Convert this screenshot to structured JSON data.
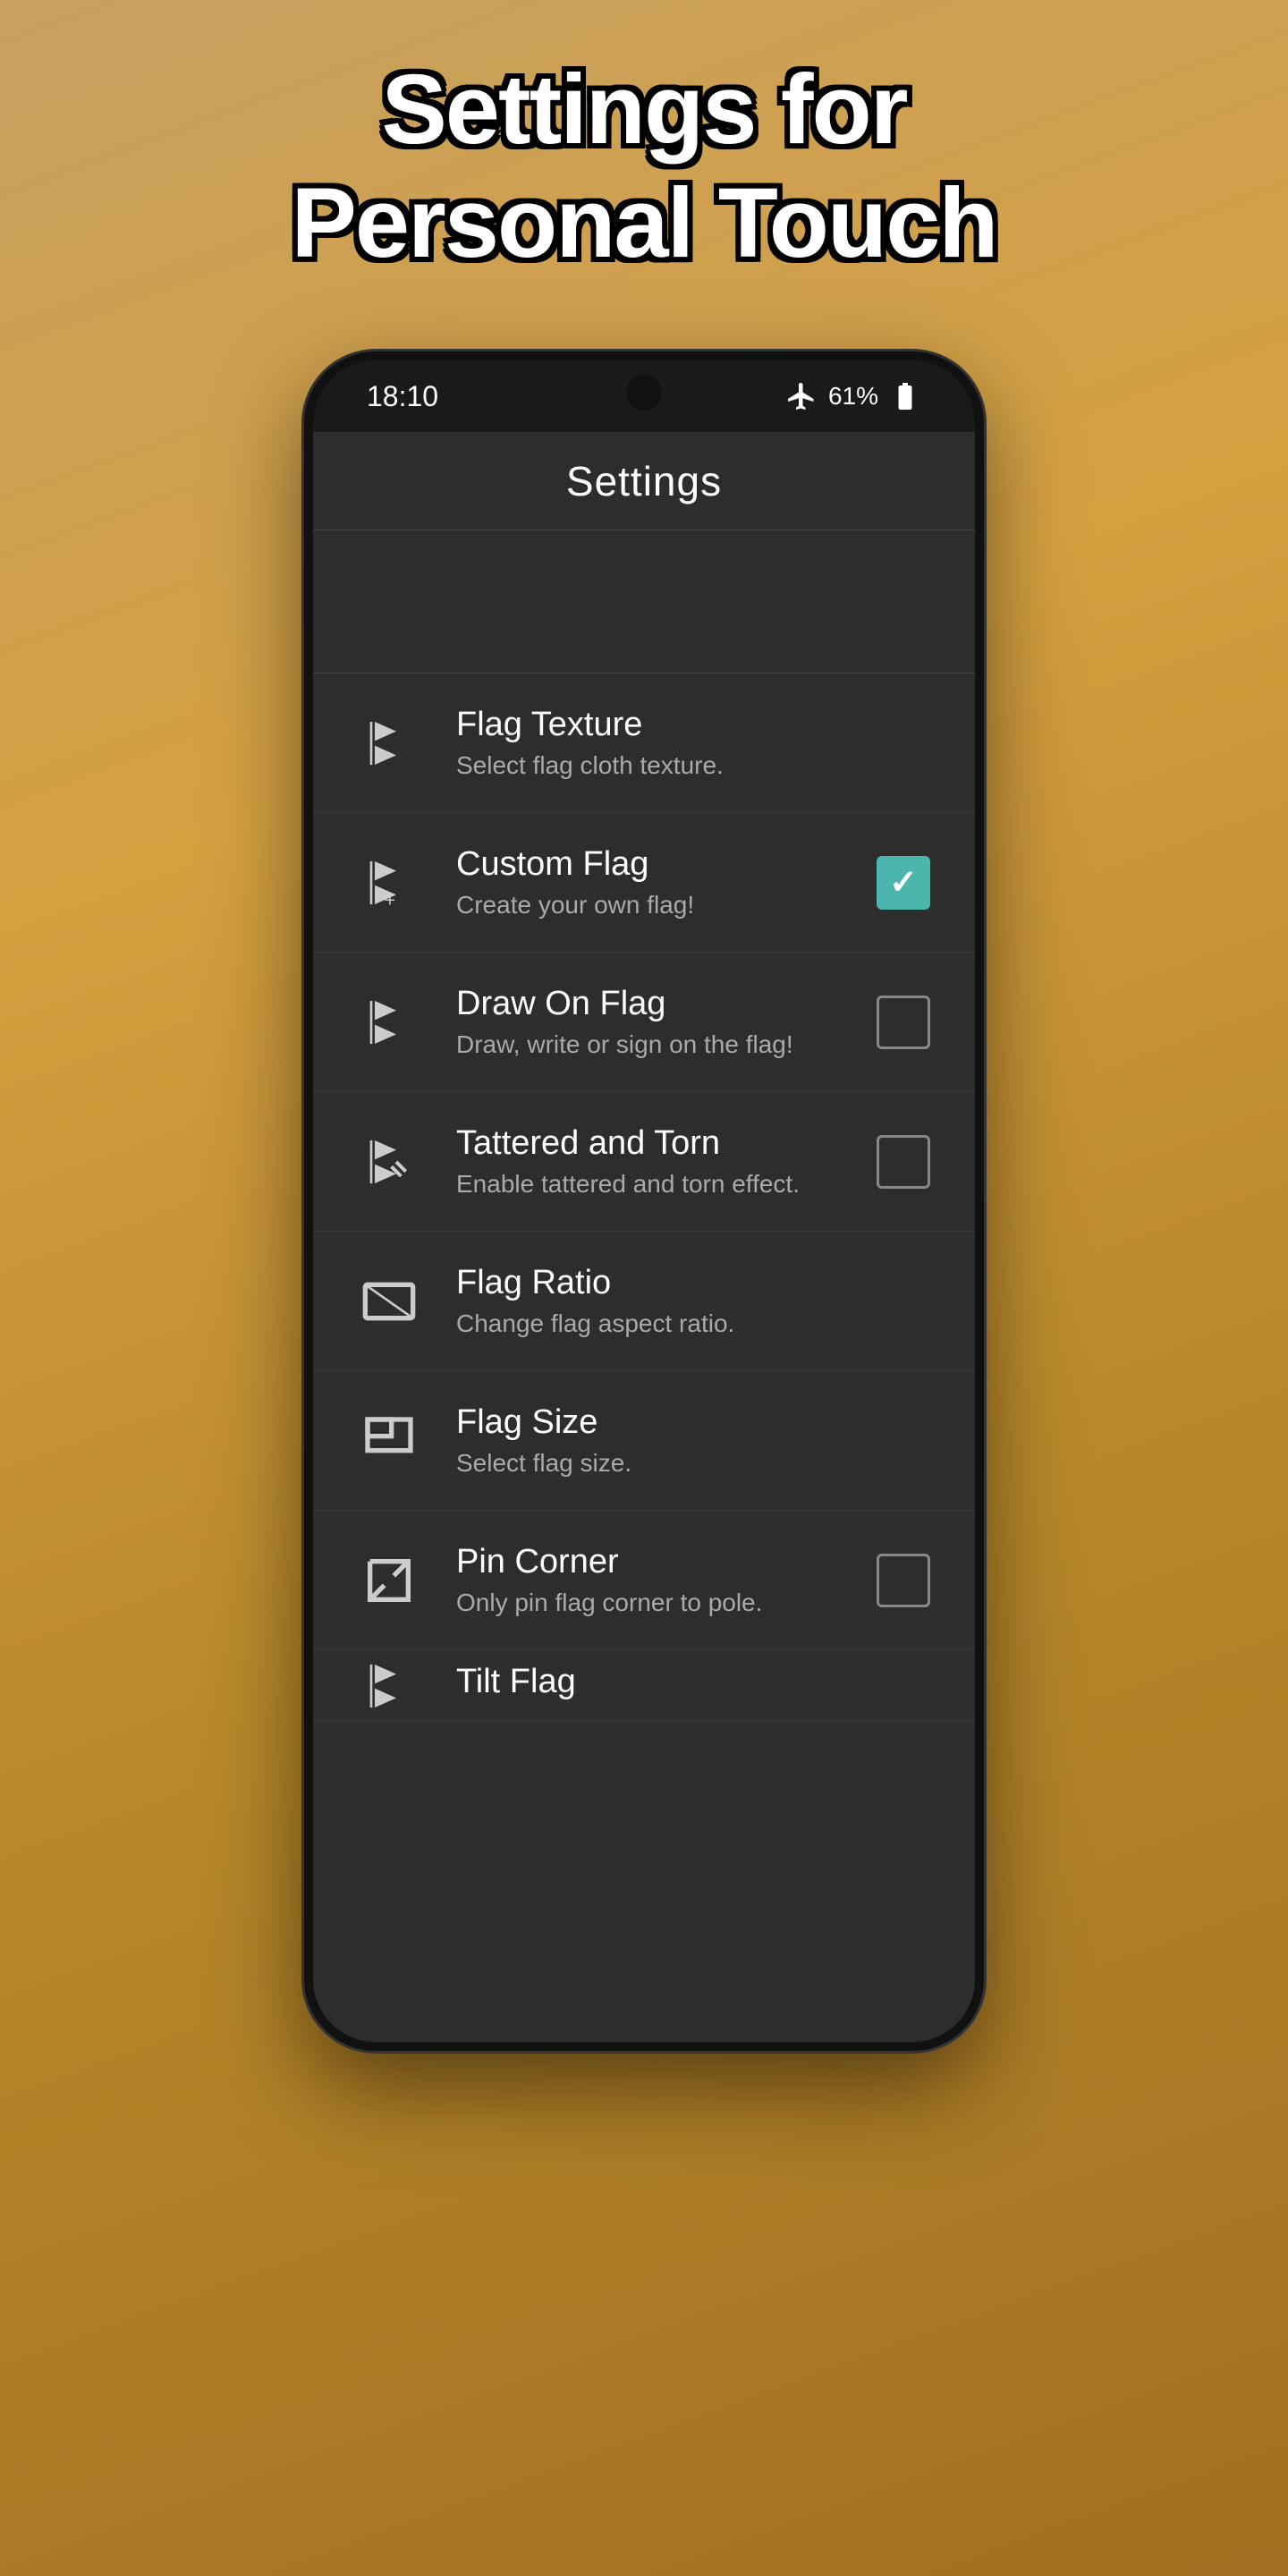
{
  "headline": {
    "line1": "Settings for",
    "line2": "Personal Touch"
  },
  "statusBar": {
    "time": "18:10",
    "battery": "61%",
    "signal_icon": "airplane-mode-icon",
    "battery_icon": "battery-icon"
  },
  "appHeader": {
    "title": "Settings"
  },
  "settingsItems": [
    {
      "id": "flag-texture",
      "icon": "flag-texture-icon",
      "title": "Flag Texture",
      "subtitle": "Select flag cloth texture.",
      "hasCheckbox": false
    },
    {
      "id": "custom-flag",
      "icon": "custom-flag-icon",
      "title": "Custom Flag",
      "subtitle": "Create your own flag!",
      "hasCheckbox": true,
      "checked": true
    },
    {
      "id": "draw-on-flag",
      "icon": "draw-flag-icon",
      "title": "Draw On Flag",
      "subtitle": "Draw, write or sign on the flag!",
      "hasCheckbox": true,
      "checked": false
    },
    {
      "id": "tattered-torn",
      "icon": "tattered-flag-icon",
      "title": "Tattered and Torn",
      "subtitle": "Enable tattered and torn effect.",
      "hasCheckbox": true,
      "checked": false
    },
    {
      "id": "flag-ratio",
      "icon": "flag-ratio-icon",
      "title": "Flag Ratio",
      "subtitle": "Change flag aspect ratio.",
      "hasCheckbox": false
    },
    {
      "id": "flag-size",
      "icon": "flag-size-icon",
      "title": "Flag Size",
      "subtitle": "Select flag size.",
      "hasCheckbox": false
    },
    {
      "id": "pin-corner",
      "icon": "pin-corner-icon",
      "title": "Pin Corner",
      "subtitle": "Only pin flag corner to pole.",
      "hasCheckbox": true,
      "checked": false
    },
    {
      "id": "tilt-flag",
      "icon": "tilt-flag-icon",
      "title": "Tilt Flag",
      "subtitle": "",
      "hasCheckbox": false,
      "partial": true
    }
  ]
}
